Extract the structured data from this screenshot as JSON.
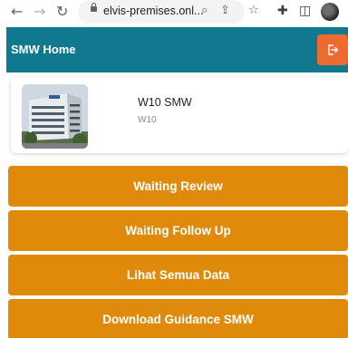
{
  "browser": {
    "back_glyph": "←",
    "forward_glyph": "→",
    "reload_glyph": "↻",
    "url": "elvis-premises.onl...",
    "zoom_glyph": "⌕",
    "share_glyph": "⇪",
    "star_glyph": "☆",
    "extensions_glyph": "✚",
    "sidepanel_glyph": "◫"
  },
  "header": {
    "title": "SMW Home",
    "logout_icon": "logout-icon",
    "color": "#107990",
    "logout_color": "#ed6b2f"
  },
  "profile": {
    "name": "W10 SMW",
    "code": "W10",
    "photo": "building-photo"
  },
  "actions": [
    {
      "label": "Waiting Review"
    },
    {
      "label": "Waiting Follow Up"
    },
    {
      "label": "Lihat Semua Data"
    },
    {
      "label": "Download Guidance SMW"
    }
  ],
  "colors": {
    "accent": "#e08a0b"
  }
}
